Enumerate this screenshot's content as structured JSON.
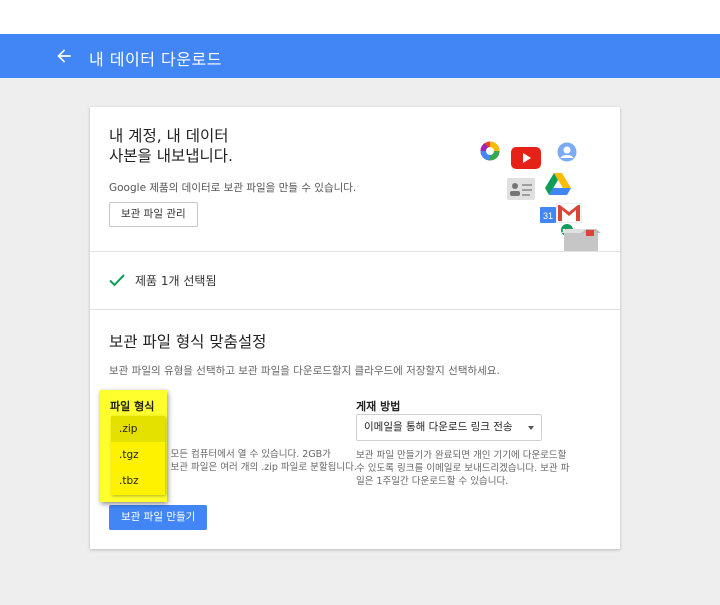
{
  "appbar": {
    "title": "내 데이터 다운로드",
    "back_icon": "arrow-back-icon",
    "color": "#4285f4"
  },
  "intro": {
    "headline_line1": "내 계정, 내 데이터",
    "headline_line2": "사본을 내보냅니다.",
    "subtext": "Google 제품의 데이터로 보관 파일을 만들 수 있습니다.",
    "manage_button": "보관 파일 관리",
    "product_icons": [
      "picasa-icon",
      "youtube-icon",
      "profile-icon",
      "contacts-icon",
      "drive-icon",
      "calendar-icon",
      "gmail-icon",
      "hangouts-icon",
      "archive-box-icon"
    ],
    "calendar_day": "31"
  },
  "selection": {
    "check_icon": "check-icon",
    "label": "제품 1개 선택됨",
    "check_color": "#0f9d58"
  },
  "customize": {
    "title": "보관 파일 형식 맞춤설정",
    "description": "보관 파일의 유형을 선택하고 보관 파일을 다운로드할지 클라우드에 저장할지 선택하세요.",
    "file_type": {
      "label": "파일 형식",
      "options": [
        ".zip",
        ".tgz",
        ".tbz"
      ],
      "selected": ".zip",
      "desc_line1": "거의 모든 컴퓨터에서 열 수 있습니다. 2GB가",
      "desc_line2": "넘는 보관 파일은 여러 개의 .zip 파일로 분할됩니다."
    },
    "delivery": {
      "label": "게재 방법",
      "selected": "이메일을 통해 다운로드 링크 전송",
      "desc_line1": "보관 파일 만들기가 완료되면 개인 기기에 다운로드할",
      "desc_line2": "수 있도록 링크를 이메일로 보내드리겠습니다. 보관 파",
      "desc_line3": "일은 1주일간 다운로드할 수 있습니다."
    },
    "create_button": "보관 파일 만들기"
  },
  "colors": {
    "accent": "#4285f4",
    "highlight": "#ffff2d"
  }
}
